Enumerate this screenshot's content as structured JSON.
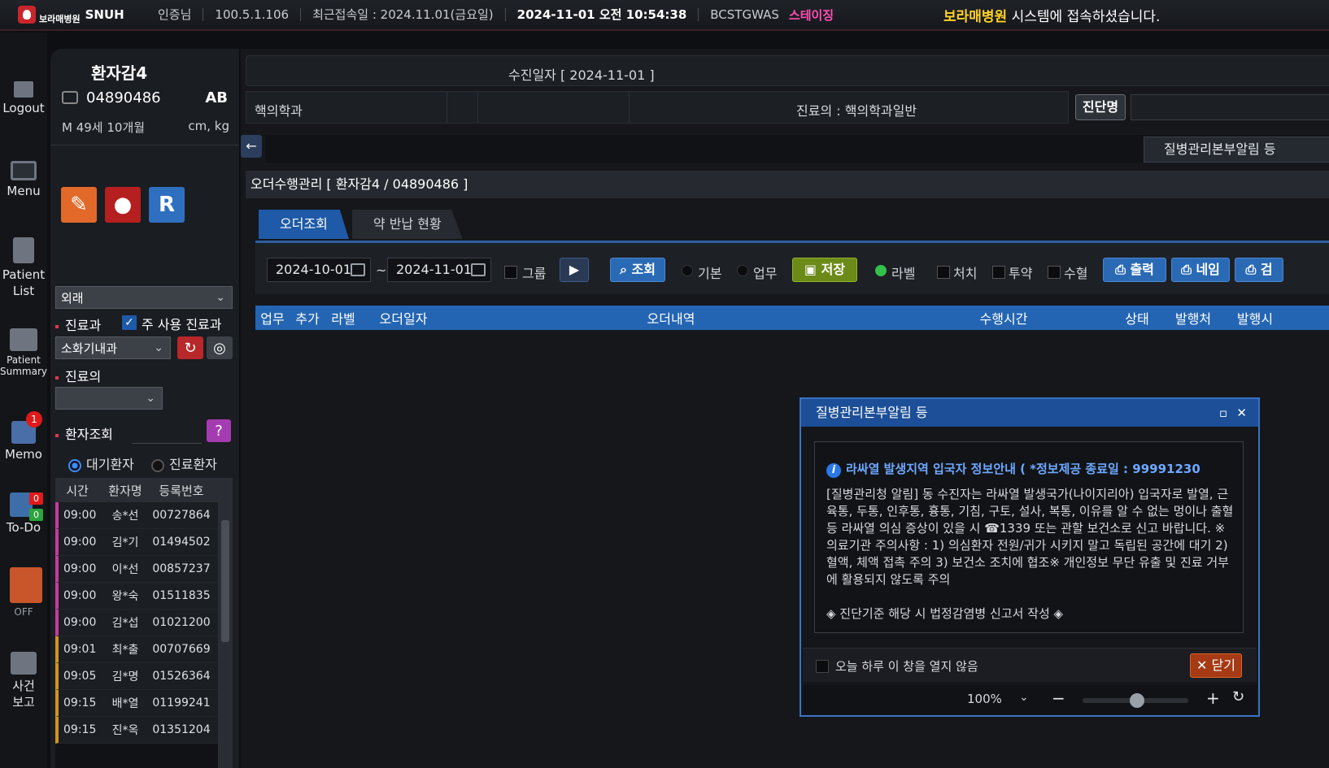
{
  "topbar": {
    "logo_hospital": "보라매병원",
    "logo_snu": "SNUH",
    "user": "인증님",
    "ip": "100.5.1.106",
    "last_login": "최근접속일 : 2024.11.01(금요일)",
    "datetime": "2024-11-01 오전 10:54:38",
    "server": "BCSTGWAS",
    "stage": "스테이징",
    "msg_hospital": "보라매병원",
    "msg_rest": " 시스템에 접속하셨습니다."
  },
  "nav": {
    "logout": "Logout",
    "menu": "Menu",
    "patient_list_1": "Patient",
    "patient_list_2": "List",
    "patient_summary_1": "Patient",
    "patient_summary_2": "Summary",
    "memo": "Memo",
    "memo_badge": "1",
    "todo": "To-Do",
    "todo_red": "0",
    "todo_green": "0",
    "off": "OFF",
    "incident_1": "사건",
    "incident_2": "보고"
  },
  "patient": {
    "name": "환자감4",
    "id": "04890486",
    "blood": "AB",
    "age": "M 49세 10개월",
    "units": "cm, kg",
    "r_icon": "R"
  },
  "filters": {
    "visit_type": "외래",
    "dept_label": "진료과",
    "main_dept_label": "주 사용 진료과",
    "dept_value": "소화기내과",
    "doctor_label": "진료의",
    "doctor_value": "",
    "search_label": "환자조회",
    "radio_wait": "대기환자",
    "radio_done": "진료환자"
  },
  "patient_list": {
    "headers": [
      "시간",
      "환자명",
      "등록번호"
    ],
    "rows": [
      {
        "time": "09:00",
        "name": "송*선",
        "id": "00727864"
      },
      {
        "time": "09:00",
        "name": "김*기",
        "id": "01494502"
      },
      {
        "time": "09:00",
        "name": "이*선",
        "id": "00857237"
      },
      {
        "time": "09:00",
        "name": "왕*숙",
        "id": "01511835"
      },
      {
        "time": "09:00",
        "name": "김*섭",
        "id": "01021200"
      },
      {
        "time": "09:01",
        "name": "최*출",
        "id": "00707669"
      },
      {
        "time": "09:05",
        "name": "김*명",
        "id": "01526364"
      },
      {
        "time": "09:15",
        "name": "배*열",
        "id": "01199241"
      },
      {
        "time": "09:15",
        "name": "진*옥",
        "id": "01351204"
      }
    ]
  },
  "header": {
    "visit_date": "수진일자 [   2024-11-01   ]",
    "dept": "핵의학과",
    "doctor": "진료의 :   핵의학과일반",
    "diag_btn": "진단명",
    "alert_btn": "질병관리본부알림 등"
  },
  "orders": {
    "title": "오더수행관리 [ 환자감4 / 04890486 ]",
    "tab1": "오더조회",
    "tab2": "약 반납 현황",
    "date_from": "2024-10-01",
    "date_to": "2024-11-01",
    "tilde": "~",
    "group": "그룹",
    "search": "조회",
    "basic": "기본",
    "work": "업무",
    "save": "저장",
    "label": "라벨",
    "treat": "처치",
    "med": "투약",
    "blood": "수혈",
    "print": "출력",
    "nail": "네임",
    "check": "검",
    "columns": [
      "업무",
      "추가",
      "라벨",
      "오더일자",
      "오더내역",
      "수행시간",
      "상태",
      "발행처",
      "발행시"
    ]
  },
  "popup": {
    "title": "질병관리본부알림 등",
    "heading": "라싸열 발생지역 입국자 정보안내 ( *정보제공 종료일 : 99991230",
    "body": "[질병관리청 알림] 동 수진자는 라싸열 발생국가(나이지리아) 입국자로 발열, 근육통, 두통, 인후통, 흉통, 기침, 구토, 설사, 복통, 이유를 알 수 없는 멍이나 출혈 등 라싸열 의심 증상이 있을 시 ☎1339 또는 관할 보건소로 신고 바랍니다. ※ 의료기관 주의사항 : 1) 의심환자 전원/귀가 시키지 말고 독립된 공간에 대기 2) 혈액, 체액 접촉 주의 3) 보건소 조치에 협조※ 개인정보 무단 유출 및 진료 거부에 활용되지 않도록 주의",
    "note": "◈ 진단기준 해당 시 법정감염병 신고서 작성 ◈",
    "dont_show": "오늘 하루 이 창을 열지 않음",
    "close": "닫기",
    "zoom": "100%"
  },
  "colors": {
    "accent": "#2465b3",
    "stage": "#ff4fb4",
    "highlight": "#ffd324"
  }
}
